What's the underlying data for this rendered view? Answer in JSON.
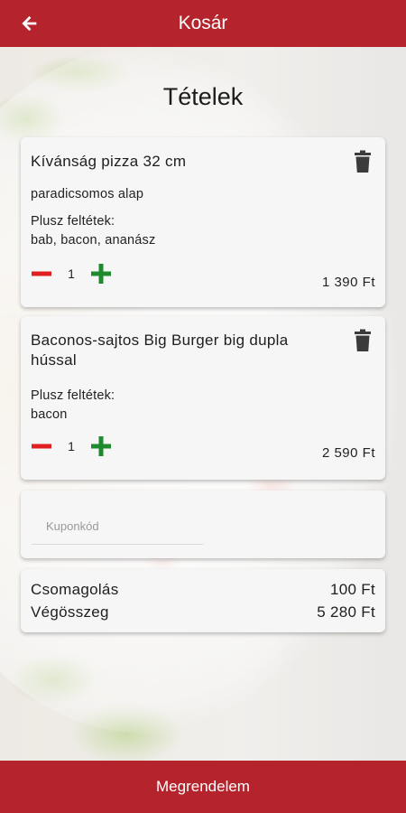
{
  "header": {
    "title": "Kosár",
    "back_icon": "arrow-left-icon"
  },
  "section_title": "Tételek",
  "items": [
    {
      "name": "Kívánság pizza 32 cm",
      "base": "paradicsomos alap",
      "extras_label": "Plusz feltétek:",
      "extras": "bab, bacon, ananász",
      "quantity": "1",
      "price": "1 390 Ft"
    },
    {
      "name": "Baconos-sajtos Big Burger big dupla hússal",
      "extras_label": "Plusz feltétek:",
      "extras": "bacon",
      "quantity": "1",
      "price": "2 590 Ft"
    }
  ],
  "coupon": {
    "placeholder": "Kuponkód",
    "value": ""
  },
  "summary": {
    "packaging_label": "Csomagolás",
    "packaging_value": "100 Ft",
    "total_label": "Végösszeg",
    "total_value": "5 280 Ft"
  },
  "footer": {
    "order_label": "Megrendelem"
  },
  "colors": {
    "brand": "#b5232c",
    "minus": "#e02020",
    "plus": "#1e8a2e"
  }
}
